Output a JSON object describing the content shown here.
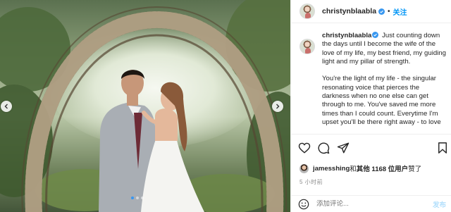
{
  "photo": {
    "alt": "wedding photo",
    "carousel": {
      "slides": 3,
      "active_index": 0
    }
  },
  "header": {
    "username": "christynblaabla",
    "separator": "•",
    "follow_label": "关注"
  },
  "caption": {
    "username": "christynblaabla",
    "paragraph_1": "Just counting down the days until I become the wife of the love of my life, my best friend, my guiding light and my pillar of strength.",
    "paragraph_2": "You're the light of my life - the singular resonating voice that pierces the darkness when no one else can get through to me. You've saved me more times than I could count. Everytime I'm upset you'll be there right away - to love"
  },
  "actions": {
    "icons": [
      "heart-icon",
      "comment-icon",
      "share-icon",
      "bookmark-icon"
    ]
  },
  "likes": {
    "user": "jamesshing",
    "and_text": " 和 ",
    "others": "其他 1168 位用户",
    "liked": " 赞了"
  },
  "timestamp": "5 小时前",
  "comment": {
    "placeholder": "添加评论...",
    "post_label": "发布"
  },
  "colors": {
    "accent": "#0095f6",
    "verified": "#3897f0",
    "border": "#efefef",
    "muted": "#8e8e8e"
  }
}
